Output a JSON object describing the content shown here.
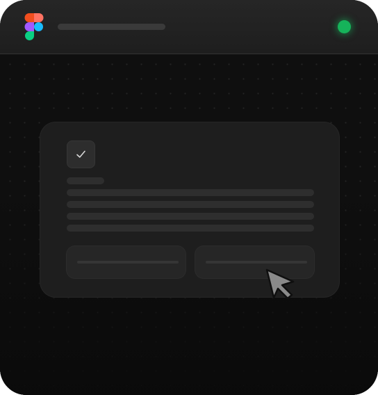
{
  "app": {
    "logo_icon": "figma-logo-icon",
    "title": "",
    "status": "online",
    "status_color": "#16b35a"
  },
  "colors": {
    "window_bg": "#0c0c0c",
    "titlebar_bg": "#232323",
    "card_bg": "#1e1e1e",
    "skeleton": "#2e2e2e",
    "figma_red": "#f24e1e",
    "figma_orange": "#ff7262",
    "figma_purple": "#a259ff",
    "figma_blue": "#1abcfe",
    "figma_green": "#0acf83"
  },
  "card": {
    "check_icon": "checkmark-icon",
    "checked": true,
    "buttons": [
      {
        "label": ""
      },
      {
        "label": ""
      }
    ]
  },
  "cursor": {
    "icon": "arrow-cursor-icon"
  }
}
